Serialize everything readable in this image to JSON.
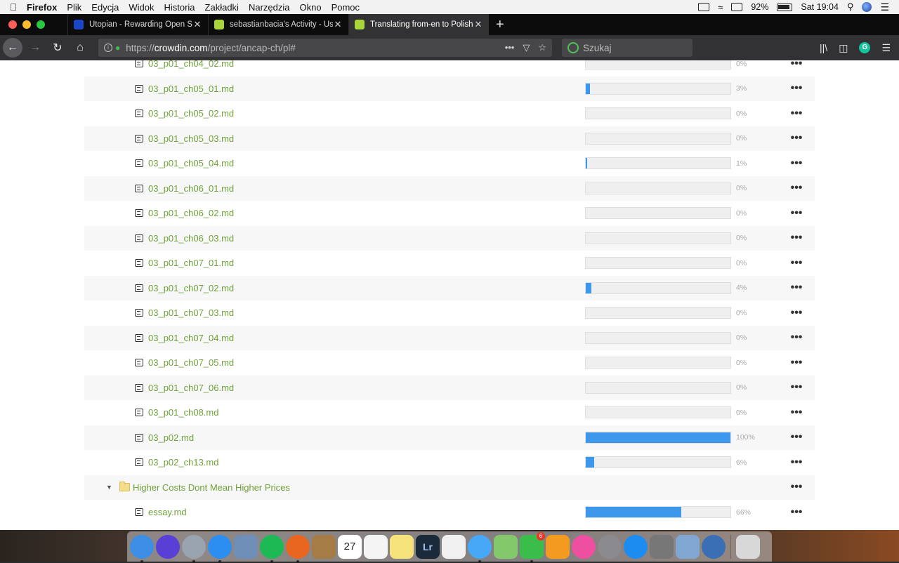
{
  "menubar": {
    "app": "Firefox",
    "items": [
      "Plik",
      "Edycja",
      "Widok",
      "Historia",
      "Zakładki",
      "Narzędzia",
      "Okno",
      "Pomoc"
    ],
    "battery": "92%",
    "clock": "Sat 19:04"
  },
  "tabs": [
    {
      "title": "Utopian - Rewarding Open Sou",
      "active": false,
      "favicon_color": "#1c46c6"
    },
    {
      "title": "sebastianbacia's Activity - Use",
      "active": false,
      "favicon_color": "#a9d43a"
    },
    {
      "title": "Translating from-en to Polish la",
      "active": true,
      "favicon_color": "#a9d43a"
    }
  ],
  "navbar": {
    "url_prefix": "https://",
    "url_host": "crowdin.com",
    "url_path": "/project/ancap-ch/pl#",
    "search_placeholder": "Szukaj"
  },
  "files": [
    {
      "name": "03_p01_ch04_02.md",
      "percent": 0,
      "label": "0%"
    },
    {
      "name": "03_p01_ch05_01.md",
      "percent": 3,
      "label": "3%"
    },
    {
      "name": "03_p01_ch05_02.md",
      "percent": 0,
      "label": "0%"
    },
    {
      "name": "03_p01_ch05_03.md",
      "percent": 0,
      "label": "0%"
    },
    {
      "name": "03_p01_ch05_04.md",
      "percent": 1,
      "label": "1%"
    },
    {
      "name": "03_p01_ch06_01.md",
      "percent": 0,
      "label": "0%"
    },
    {
      "name": "03_p01_ch06_02.md",
      "percent": 0,
      "label": "0%"
    },
    {
      "name": "03_p01_ch06_03.md",
      "percent": 0,
      "label": "0%"
    },
    {
      "name": "03_p01_ch07_01.md",
      "percent": 0,
      "label": "0%"
    },
    {
      "name": "03_p01_ch07_02.md",
      "percent": 4,
      "label": "4%"
    },
    {
      "name": "03_p01_ch07_03.md",
      "percent": 0,
      "label": "0%"
    },
    {
      "name": "03_p01_ch07_04.md",
      "percent": 0,
      "label": "0%"
    },
    {
      "name": "03_p01_ch07_05.md",
      "percent": 0,
      "label": "0%"
    },
    {
      "name": "03_p01_ch07_06.md",
      "percent": 0,
      "label": "0%"
    },
    {
      "name": "03_p01_ch08.md",
      "percent": 0,
      "label": "0%"
    },
    {
      "name": "03_p02.md",
      "percent": 100,
      "label": "100%"
    },
    {
      "name": "03_p02_ch13.md",
      "percent": 6,
      "label": "6%"
    }
  ],
  "folder": {
    "name": "Higher Costs Dont Mean Higher Prices"
  },
  "folder_files": [
    {
      "name": "essay.md",
      "percent": 66,
      "label": "66%"
    }
  ],
  "more_label": "•••",
  "dock": {
    "calendar_day": "27",
    "messages_badge": "6",
    "icons": [
      {
        "name": "finder",
        "color": "#3d8fe6"
      },
      {
        "name": "siri",
        "color": "#5a3fd6"
      },
      {
        "name": "launchpad",
        "color": "#9aa4b0"
      },
      {
        "name": "safari",
        "color": "#2c8ef0"
      },
      {
        "name": "preview",
        "color": "#6f8fb8"
      },
      {
        "name": "spotify",
        "color": "#1db954"
      },
      {
        "name": "firefox",
        "color": "#e8661f"
      },
      {
        "name": "notebook",
        "color": "#a57c45"
      },
      {
        "name": "calendar",
        "color": "#ffffff"
      },
      {
        "name": "reminders",
        "color": "#f4f4f4"
      },
      {
        "name": "notes",
        "color": "#f6e27a"
      },
      {
        "name": "lightroom",
        "color": "#1b2a3b"
      },
      {
        "name": "photos",
        "color": "#f0f0f0"
      },
      {
        "name": "messages",
        "color": "#46a8f6"
      },
      {
        "name": "maps",
        "color": "#83c86a"
      },
      {
        "name": "facetime",
        "color": "#3bbd4c"
      },
      {
        "name": "ibooks",
        "color": "#f59a21"
      },
      {
        "name": "itunes",
        "color": "#ef4fa0"
      },
      {
        "name": "system-preferences",
        "color": "#8a8a8f"
      },
      {
        "name": "app-store",
        "color": "#1d8cf0"
      },
      {
        "name": "utility",
        "color": "#777777"
      },
      {
        "name": "image-capture",
        "color": "#7fa7d1"
      },
      {
        "name": "quicktime",
        "color": "#3a6fb5"
      },
      {
        "name": "trash",
        "color": "#d8d8d8"
      }
    ]
  }
}
